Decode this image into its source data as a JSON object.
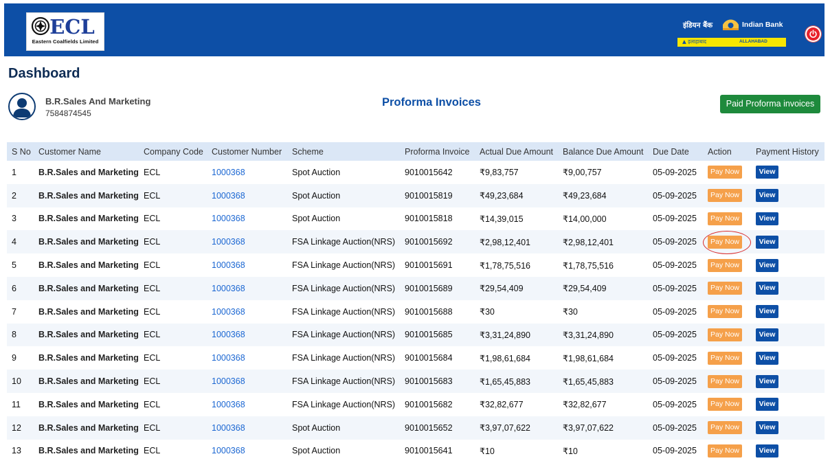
{
  "header": {
    "ecl_logo_text": "ECL",
    "ecl_subtitle": "Eastern Coalfields Limited",
    "bank_hindi": "इंडियन बैंक",
    "bank_name": "Indian Bank",
    "bank_strip_hindi": "▲ इलाहाबाद",
    "bank_strip_english": "ALLAHABAD",
    "brand_color": "#0d4fa6"
  },
  "page": {
    "title": "Dashboard",
    "section_title": "Proforma Invoices",
    "paid_button_label": "Paid Proforma invoices"
  },
  "user": {
    "name": "B.R.Sales And Marketing",
    "phone": "7584874545"
  },
  "table": {
    "columns": [
      "S No",
      "Customer Name",
      "Company Code",
      "Customer Number",
      "Scheme",
      "Proforma Invoice",
      "Actual Due Amount",
      "Balance Due Amount",
      "Due Date",
      "Action",
      "Payment History"
    ],
    "pay_label": "Pay Now",
    "view_label": "View",
    "rows": [
      {
        "sno": "1",
        "customer_name": "B.R.Sales and Marketing",
        "company_code": "ECL",
        "customer_number": "1000368",
        "scheme": "Spot Auction",
        "proforma_invoice": "9010015642",
        "actual_due": "₹9,83,757",
        "balance_due": "₹9,00,757",
        "due_date": "05-09-2025"
      },
      {
        "sno": "2",
        "customer_name": "B.R.Sales and Marketing",
        "company_code": "ECL",
        "customer_number": "1000368",
        "scheme": "Spot Auction",
        "proforma_invoice": "9010015819",
        "actual_due": "₹49,23,684",
        "balance_due": "₹49,23,684",
        "due_date": "05-09-2025"
      },
      {
        "sno": "3",
        "customer_name": "B.R.Sales and Marketing",
        "company_code": "ECL",
        "customer_number": "1000368",
        "scheme": "Spot Auction",
        "proforma_invoice": "9010015818",
        "actual_due": "₹14,39,015",
        "balance_due": "₹14,00,000",
        "due_date": "05-09-2025"
      },
      {
        "sno": "4",
        "customer_name": "B.R.Sales and Marketing",
        "company_code": "ECL",
        "customer_number": "1000368",
        "scheme": "FSA Linkage Auction(NRS)",
        "proforma_invoice": "9010015692",
        "actual_due": "₹2,98,12,401",
        "balance_due": "₹2,98,12,401",
        "due_date": "05-09-2025"
      },
      {
        "sno": "5",
        "customer_name": "B.R.Sales and Marketing",
        "company_code": "ECL",
        "customer_number": "1000368",
        "scheme": "FSA Linkage Auction(NRS)",
        "proforma_invoice": "9010015691",
        "actual_due": "₹1,78,75,516",
        "balance_due": "₹1,78,75,516",
        "due_date": "05-09-2025"
      },
      {
        "sno": "6",
        "customer_name": "B.R.Sales and Marketing",
        "company_code": "ECL",
        "customer_number": "1000368",
        "scheme": "FSA Linkage Auction(NRS)",
        "proforma_invoice": "9010015689",
        "actual_due": "₹29,54,409",
        "balance_due": "₹29,54,409",
        "due_date": "05-09-2025"
      },
      {
        "sno": "7",
        "customer_name": "B.R.Sales and Marketing",
        "company_code": "ECL",
        "customer_number": "1000368",
        "scheme": "FSA Linkage Auction(NRS)",
        "proforma_invoice": "9010015688",
        "actual_due": "₹30",
        "balance_due": "₹30",
        "due_date": "05-09-2025"
      },
      {
        "sno": "8",
        "customer_name": "B.R.Sales and Marketing",
        "company_code": "ECL",
        "customer_number": "1000368",
        "scheme": "FSA Linkage Auction(NRS)",
        "proforma_invoice": "9010015685",
        "actual_due": "₹3,31,24,890",
        "balance_due": "₹3,31,24,890",
        "due_date": "05-09-2025"
      },
      {
        "sno": "9",
        "customer_name": "B.R.Sales and Marketing",
        "company_code": "ECL",
        "customer_number": "1000368",
        "scheme": "FSA Linkage Auction(NRS)",
        "proforma_invoice": "9010015684",
        "actual_due": "₹1,98,61,684",
        "balance_due": "₹1,98,61,684",
        "due_date": "05-09-2025"
      },
      {
        "sno": "10",
        "customer_name": "B.R.Sales and Marketing",
        "company_code": "ECL",
        "customer_number": "1000368",
        "scheme": "FSA Linkage Auction(NRS)",
        "proforma_invoice": "9010015683",
        "actual_due": "₹1,65,45,883",
        "balance_due": "₹1,65,45,883",
        "due_date": "05-09-2025"
      },
      {
        "sno": "11",
        "customer_name": "B.R.Sales and Marketing",
        "company_code": "ECL",
        "customer_number": "1000368",
        "scheme": "FSA Linkage Auction(NRS)",
        "proforma_invoice": "9010015682",
        "actual_due": "₹32,82,677",
        "balance_due": "₹32,82,677",
        "due_date": "05-09-2025"
      },
      {
        "sno": "12",
        "customer_name": "B.R.Sales and Marketing",
        "company_code": "ECL",
        "customer_number": "1000368",
        "scheme": "Spot Auction",
        "proforma_invoice": "9010015652",
        "actual_due": "₹3,97,07,622",
        "balance_due": "₹3,97,07,622",
        "due_date": "05-09-2025"
      },
      {
        "sno": "13",
        "customer_name": "B.R.Sales and Marketing",
        "company_code": "ECL",
        "customer_number": "1000368",
        "scheme": "Spot Auction",
        "proforma_invoice": "9010015641",
        "actual_due": "₹10",
        "balance_due": "₹10",
        "due_date": "05-09-2025"
      }
    ]
  }
}
